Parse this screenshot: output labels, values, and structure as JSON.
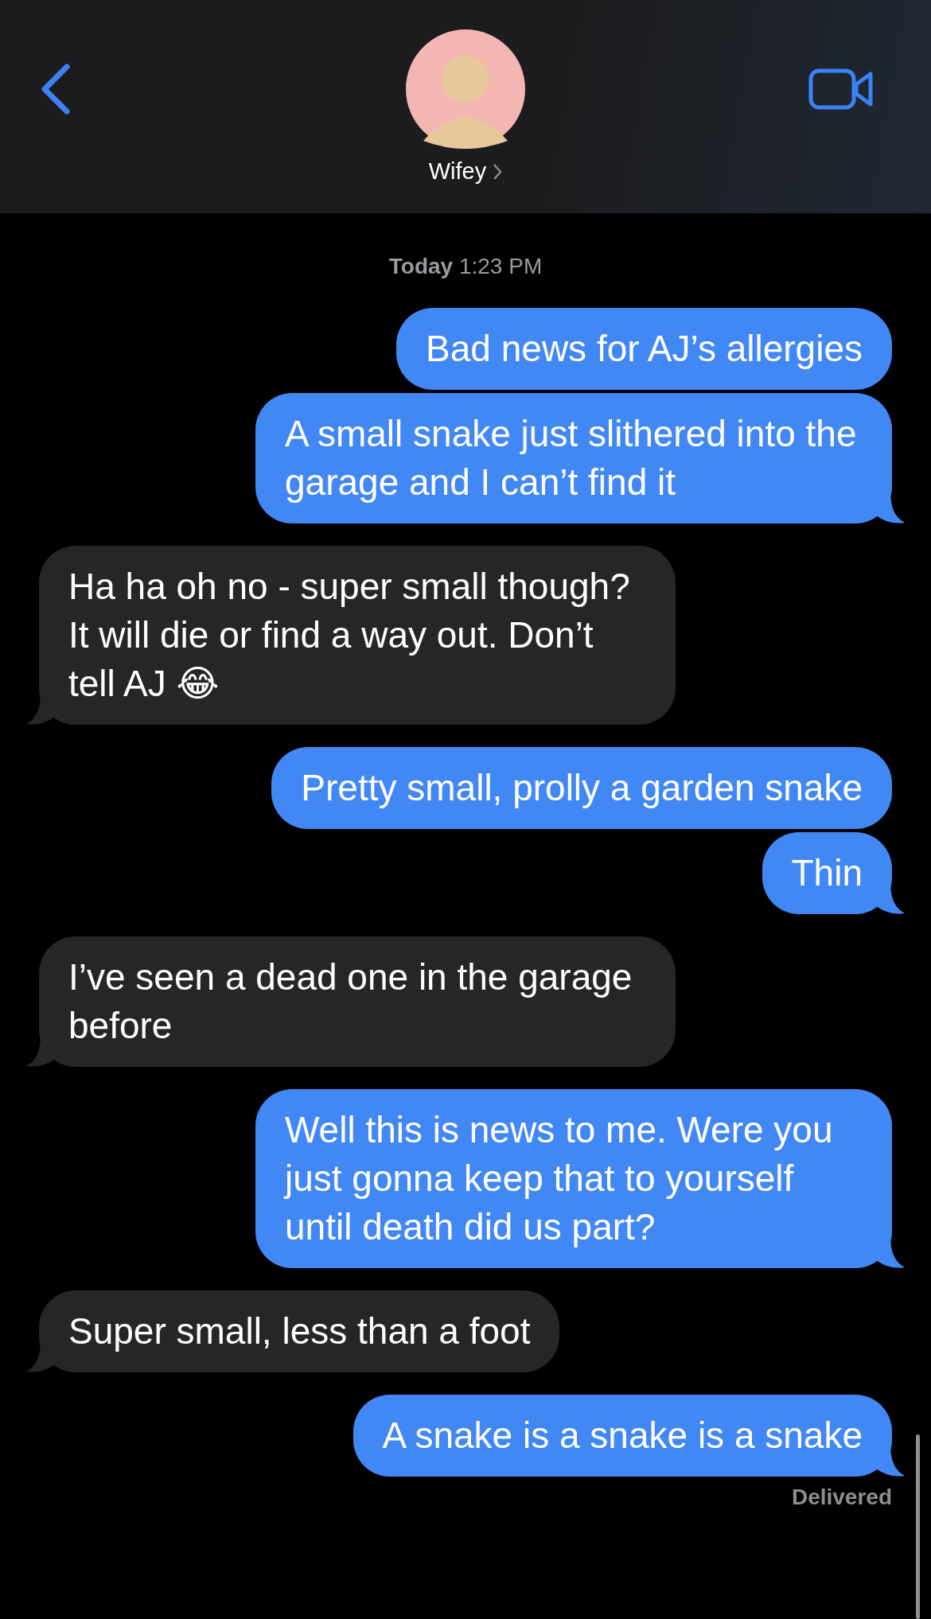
{
  "header": {
    "contact_name": "Wifey"
  },
  "timestamp": "**Today** 1:23 PM",
  "messages": [
    {
      "kind": "sent",
      "text": "Bad news for AJ’s allergies",
      "tail": false
    },
    {
      "kind": "sent",
      "text": "A small snake just slithered into the garage and I can’t find it",
      "tail": true
    },
    {
      "kind": "received",
      "text": "Ha ha oh no - super small though? It will die or find a way out. Don’t tell AJ 😂",
      "tail": true
    },
    {
      "kind": "sent",
      "text": "Pretty small, prolly a garden snake",
      "tail": false
    },
    {
      "kind": "sent",
      "text": "Thin",
      "tail": true
    },
    {
      "kind": "received",
      "text": "I’ve seen a dead one in the garage before",
      "tail": true
    },
    {
      "kind": "sent",
      "text": "Well this is news to me. Were you just gonna keep that to yourself until death did us part?",
      "tail": true
    },
    {
      "kind": "received",
      "text": "Super small, less than a foot",
      "tail": true
    },
    {
      "kind": "sent",
      "text": "A snake is a snake is a snake",
      "tail": true
    }
  ],
  "status": "Delivered"
}
